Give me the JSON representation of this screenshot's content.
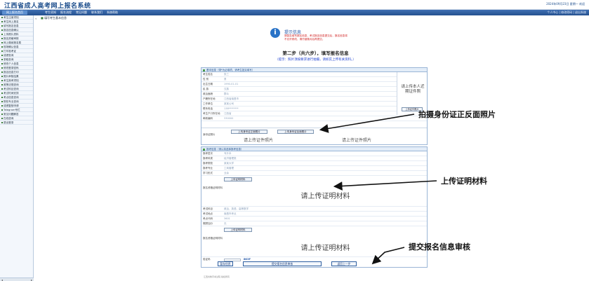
{
  "header": {
    "title": "江西省成人高考网上报名系统",
    "right_info": "2024年09月23日 星期一 欢迎"
  },
  "nav": {
    "home": "网上报名首页",
    "items": [
      "考生须知",
      "报名流程",
      "常见问题",
      "联系我们",
      "系统帮助"
    ],
    "right": "个人中心 | 修改密码 | 退出系统"
  },
  "sidebar": {
    "items": [
      "考生注册须知",
      "考生网上报名",
      "填写报名信息",
      "报名信息确认",
      "上传照片资料",
      "报名资格审核",
      "网上缴纳报名费",
      "现场确认信息",
      "打印准考证",
      "成绩查询",
      "录取查询",
      "修改个人信息",
      "修改登录密码",
      "报名信息打印",
      "照片审核结果",
      "考生报考须知",
      "政策法规查询",
      "考试科目查询",
      "考试时间安排",
      "考点信息查询",
      "院校专业查询",
      "成绩复核申请",
      "Telegram专栏",
      "常见问题解答",
      "在线咨询",
      "退出登录"
    ]
  },
  "breadcrumb": "填写考生基本信息",
  "notice": {
    "title": "提示信息",
    "text": "请如实填写报名信息，考试报名信息提交后，报名信息将不允许修改，请仔细核对后再提交。"
  },
  "step": {
    "title": "第二步（共六步），填写报名信息",
    "subtitle": "（提示：照片须按要求进行拍摄，请如实上传有关资料。）"
  },
  "form1": {
    "header": "基本信息（带*为必填项，请考生如实填写）",
    "rows": [
      {
        "label": "考生姓名",
        "value": "张三"
      },
      {
        "label": "性  别",
        "value": "男"
      },
      {
        "label": "出生日期",
        "value": "1990-01-01"
      },
      {
        "label": "民  族",
        "value": "汉族"
      },
      {
        "label": "政治面貌",
        "value": "群众"
      },
      {
        "label": "户籍所在地",
        "value": "江西省南昌市"
      },
      {
        "label": "工作单位",
        "value": "某某公司"
      },
      {
        "label": "联系电话",
        "value": "138********"
      },
      {
        "label": "考生户口所在地",
        "value": "江西省"
      },
      {
        "label": "邮政编码",
        "value": "330000"
      }
    ],
    "photo_hint": "请上传本人近期证件照",
    "photo_button": "上传证件照片",
    "id_card_label": "身份证照片",
    "id_front_button": "上传身份证正面照片",
    "id_back_button": "上传身份证反面照片",
    "id_front_hint": "请上传证件照片",
    "id_back_hint": "请上传证件照片"
  },
  "form2": {
    "header": "报考信息（请认真选择报考信息）",
    "rows": [
      {
        "label": "报考层次",
        "value": "专升本"
      },
      {
        "label": "报考科类",
        "value": "经济管理类"
      },
      {
        "label": "报考院校",
        "value": "某某大学"
      },
      {
        "label": "报考专业",
        "value": "工商管理"
      },
      {
        "label": "学习形式",
        "value": "业余"
      }
    ],
    "proof_label": "报名资格证明材料",
    "proof_button": "上传证明材料",
    "proof_hint_1": "请上传证明材料",
    "proof_hint_2": "请上传证明材料",
    "extra_rows": [
      {
        "label": "考试科目",
        "value": "政治、英语、高等数学"
      },
      {
        "label": "考试地点",
        "value": "南昌市考点"
      },
      {
        "label": "考点代码",
        "value": "3601"
      },
      {
        "label": "照顾加分",
        "value": "无"
      }
    ],
    "verify_label": "验证码",
    "verify_code": "8K3F"
  },
  "submit": {
    "save": "暂存信息",
    "submit_review": "提交报名信息审核",
    "back": "返回上一步"
  },
  "footer": "江西省教育考试院 版权所有",
  "annotations": {
    "idcard": "拍摄身份证正反面照片",
    "proof": "上传证明材料",
    "submit": "提交报名信息审核"
  }
}
